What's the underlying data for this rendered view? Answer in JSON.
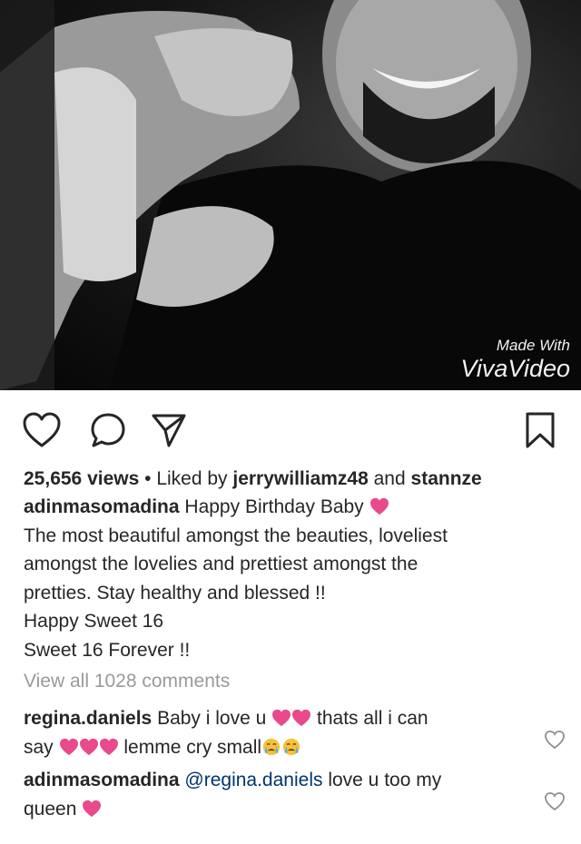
{
  "media": {
    "watermark_small": "Made With",
    "watermark_large": "VivaVideo"
  },
  "actions": {
    "like_icon": "heart-outline-icon",
    "comment_icon": "speech-bubble-icon",
    "share_icon": "paper-plane-icon",
    "save_icon": "bookmark-icon"
  },
  "post": {
    "views": "25,656 views",
    "separator": " • ",
    "liked_by_prefix": "Liked by ",
    "liked_user": "jerrywilliamz48",
    "and_text": " and ",
    "liked_other": "stannze",
    "author": "adinmasomadina",
    "caption_lines": [
      "Happy Birthday Baby",
      "The most beautiful amongst the beauties, loveliest",
      "amongst the lovelies and prettiest amongst the",
      "pretties. Stay healthy and blessed !!",
      "Happy Sweet 16",
      "Sweet 16 Forever !!"
    ],
    "view_all_comments": "View all 1028 comments"
  },
  "comments": [
    {
      "user": "regina.daniels",
      "text_1": "Baby i love u",
      "text_2": "thats all i can",
      "text_3": "say",
      "text_4": "lemme cry small"
    },
    {
      "user": "adinmasomadina",
      "mention": "@regina.daniels",
      "text_1": "love u too my",
      "text_2": "queen"
    }
  ],
  "colors": {
    "heart": "#e84a8c",
    "muted": "#9a9a9a",
    "mention": "#003569"
  }
}
